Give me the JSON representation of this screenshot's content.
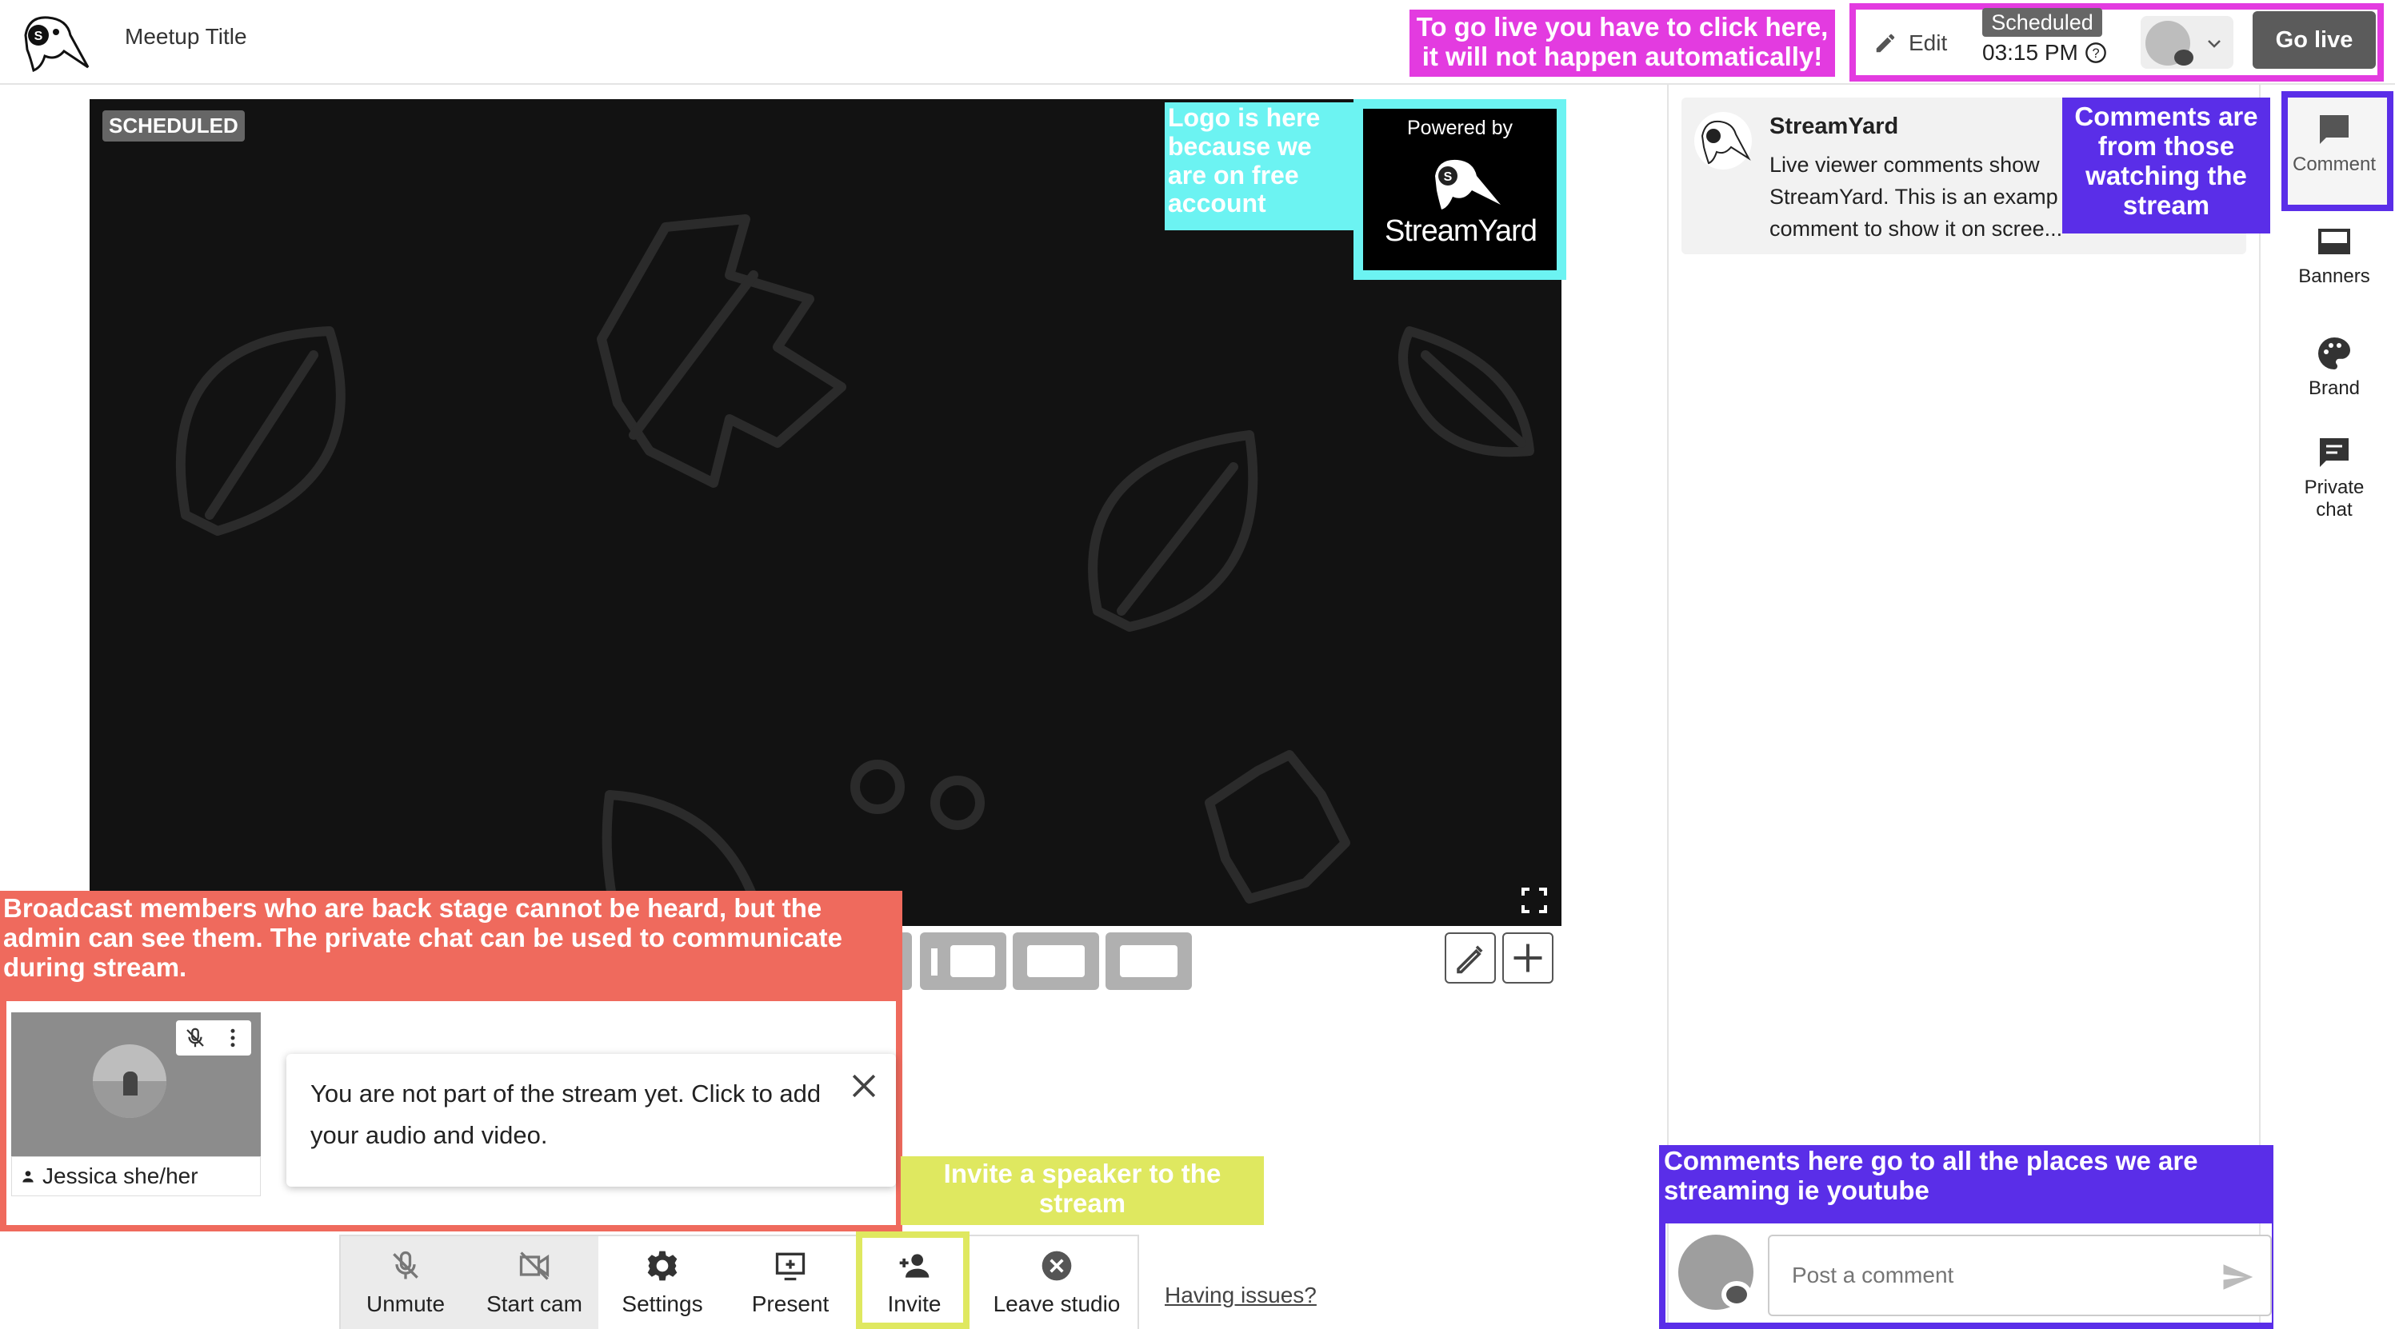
{
  "header": {
    "title": "Meetup Title",
    "edit_label": "Edit",
    "status_badge": "Scheduled",
    "time": "03:15 PM",
    "go_live_label": "Go live"
  },
  "annotations": {
    "go_live": "To go live you have to click here, it will not happen automatically!",
    "logo": "Logo is here because we are on free account",
    "backstage": "Broadcast members who are back stage cannot be heard, but the admin can see them. The private chat can be used to communicate during stream.",
    "invite": "Invite a speaker to the stream",
    "comments": "Comments are from those watching the stream",
    "post": "Comments here go to all the places we are streaming ie youtube"
  },
  "stage": {
    "badge": "SCHEDULED",
    "powered_by": "Powered by",
    "brand": "StreamYard"
  },
  "backstage": {
    "guest_name": "Jessica she/her",
    "tooltip": "You are not part of the stream yet. Click to add your audio and video."
  },
  "toolbar": {
    "unmute": "Unmute",
    "start_cam": "Start cam",
    "settings": "Settings",
    "present": "Present",
    "invite": "Invite",
    "leave": "Leave studio",
    "having_issues": "Having issues?"
  },
  "comments": {
    "author": "StreamYard",
    "text": "Live viewer comments show\nStreamYard. This is an examp\ncomment to show it on scree...",
    "post_placeholder": "Post a comment"
  },
  "rail": {
    "comments": "Comment",
    "banners": "Banners",
    "brand": "Brand",
    "private_chat": "Private\nchat"
  },
  "colors": {
    "annot_pink": "#e33be0",
    "annot_cyan": "#6cf3f2",
    "annot_red": "#ef6a5d",
    "annot_yellow": "#dfe860",
    "annot_purple": "#5a2ee8",
    "stage_bg": "#121212"
  }
}
